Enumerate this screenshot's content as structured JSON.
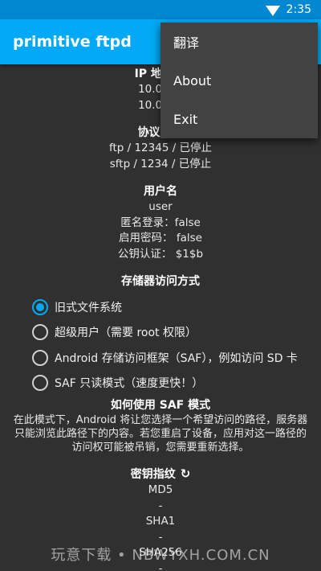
{
  "statusbar": {
    "time": "2:35",
    "wifi_icon": "wifi-icon"
  },
  "appbar": {
    "title": "primitive ftpd"
  },
  "menu": {
    "items": [
      {
        "label": "翻译"
      },
      {
        "label": "About"
      },
      {
        "label": "Exit"
      }
    ]
  },
  "ip": {
    "title": "IP 地址 (I",
    "lines": [
      "10.0.3.1",
      "10.0.2.1"
    ]
  },
  "protocol": {
    "title": "协议 / 端",
    "lines": [
      "ftp / 12345 / 已停止",
      "sftp / 1234 / 已停止"
    ]
  },
  "user": {
    "title": "用户名",
    "lines": [
      "user",
      "匿名登录：false",
      "启用密码：   false",
      "公钥认证：  $1$b"
    ]
  },
  "storage": {
    "title": "存储器访问方式",
    "options": [
      {
        "label": "旧式文件系统",
        "selected": true
      },
      {
        "label": "超级用户（需要 root 权限）",
        "selected": false
      },
      {
        "label": "Android 存储访问框架（SAF），例如访问 SD 卡",
        "selected": false
      },
      {
        "label": "SAF 只读模式（速度更快！）",
        "selected": false
      }
    ]
  },
  "saf_help": {
    "title": "如何使用 SAF 模式",
    "lines": [
      "在此模式下，Android 将让您选择一个希望访问的路径，服务器",
      "只能浏览此路径下的内容。若您重启了设备，应用对这一路径的",
      "访问权可能被吊销，您需要重新选择。"
    ]
  },
  "fingerprints": {
    "title": "密钥指纹",
    "refresh_icon": "refresh-icon",
    "md5_label": "MD5",
    "md5_value": "-",
    "sha1_label": "SHA1",
    "sha1_value": "-",
    "sha256_label": "SHA256",
    "sha256_value": "-"
  },
  "watermark": "玩意下载 • NBWYXH.COM.CN",
  "colors": {
    "accent": "#03a9f4",
    "statusbar": "#0288d1",
    "background": "#303030",
    "menu": "#424242"
  }
}
